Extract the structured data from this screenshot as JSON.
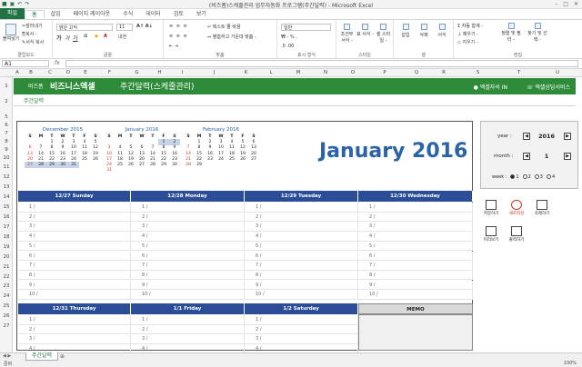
{
  "window": {
    "title": "(비즈폼)스케줄관리 업무자동화 프로그램(주간달력) - Microsoft Excel",
    "controls": [
      "–",
      "□",
      "✕"
    ]
  },
  "ribbon_tabs": [
    {
      "label": "파일"
    },
    {
      "label": "홈"
    },
    {
      "label": "삽입"
    },
    {
      "label": "페이지 레이아웃"
    },
    {
      "label": "수식"
    },
    {
      "label": "데이터"
    },
    {
      "label": "검토"
    },
    {
      "label": "보기"
    }
  ],
  "ribbon": {
    "clipboard": {
      "paste": "붙여넣기",
      "cut": "잘라내기",
      "copy": "복사 -",
      "format_painter": "서식 복사",
      "group": "클립보드"
    },
    "font": {
      "name": "맑은 고딕",
      "size": "11",
      "group": "글꼴"
    },
    "alignment": {
      "wrap": "텍스트 줄 바꿈",
      "merge": "병합하고 가운데 맞춤 -",
      "group": "맞춤"
    },
    "number": {
      "format": "일반",
      "group": "표시 형식"
    },
    "styles": {
      "cond": "조건부 서식 -",
      "table": "표 서식 -",
      "cell": "셀 스타일 -",
      "group": "스타일"
    },
    "cells": {
      "insert": "삽입",
      "delete": "삭제",
      "format": "서식",
      "group": "셀"
    },
    "editing": {
      "autosum": "자동 합계 -",
      "fill": "채우기 -",
      "clear": "지우기 -",
      "sort": "정렬 및 필터 -",
      "find": "찾기 및 선택 -",
      "group": "편집"
    }
  },
  "formula_bar": {
    "name_box": "A1",
    "fx": "fx",
    "value": ""
  },
  "columns": [
    "A",
    "B",
    "C",
    "D",
    "E",
    "F",
    "G",
    "H",
    "I",
    "J",
    "K",
    "L",
    "M",
    "N",
    "O",
    "P",
    "Q",
    "R",
    "S",
    "T",
    "U"
  ],
  "rows": [
    "1",
    "2",
    "5",
    "6",
    "7",
    "8",
    "9",
    "10",
    "11",
    "12",
    "13",
    "14",
    "15",
    "16",
    "17",
    "18",
    "19",
    "20",
    "21",
    "22",
    "23",
    "24",
    "25",
    "26",
    "27"
  ],
  "banner": {
    "brand_small": "비즈폼",
    "brand": "비즈니스엑셀",
    "title": "주간달력(스케줄관리)",
    "link1": "엑셀자석 IN",
    "link2": "엑셀상담서비스"
  },
  "subtitle": "주간달력",
  "mini_calendars": [
    {
      "title": "December 2015",
      "dow": [
        "S",
        "M",
        "T",
        "W",
        "T",
        "F",
        "S"
      ],
      "weeks": [
        [
          "",
          "",
          "1",
          "2",
          "3",
          "4",
          "5"
        ],
        [
          "6",
          "7",
          "8",
          "9",
          "10",
          "11",
          "12"
        ],
        [
          "13",
          "14",
          "15",
          "16",
          "17",
          "18",
          "19"
        ],
        [
          "20",
          "21",
          "22",
          "23",
          "24",
          "25",
          "26"
        ],
        [
          "27",
          "28",
          "29",
          "30",
          "31",
          "",
          ""
        ],
        [
          "",
          "",
          "",
          "",
          "",
          "",
          ""
        ]
      ]
    },
    {
      "title": "January 2016",
      "dow": [
        "S",
        "M",
        "T",
        "W",
        "T",
        "F",
        "S"
      ],
      "weeks": [
        [
          "",
          "",
          "",
          "",
          "",
          "1",
          "2"
        ],
        [
          "3",
          "4",
          "5",
          "6",
          "7",
          "8",
          "9"
        ],
        [
          "10",
          "11",
          "12",
          "13",
          "14",
          "15",
          "16"
        ],
        [
          "17",
          "18",
          "19",
          "20",
          "21",
          "22",
          "23"
        ],
        [
          "24",
          "25",
          "26",
          "27",
          "28",
          "29",
          "30"
        ],
        [
          "31",
          "",
          "",
          "",
          "",
          "",
          ""
        ]
      ]
    },
    {
      "title": "February 2016",
      "dow": [
        "S",
        "M",
        "T",
        "W",
        "T",
        "F",
        "S"
      ],
      "weeks": [
        [
          "",
          "1",
          "2",
          "3",
          "4",
          "5",
          "6"
        ],
        [
          "7",
          "8",
          "9",
          "10",
          "11",
          "12",
          "13"
        ],
        [
          "14",
          "15",
          "16",
          "17",
          "18",
          "19",
          "20"
        ],
        [
          "21",
          "22",
          "23",
          "24",
          "25",
          "26",
          "27"
        ],
        [
          "28",
          "29",
          "",
          "",
          "",
          "",
          ""
        ],
        [
          "",
          "",
          "",
          "",
          "",
          "",
          ""
        ]
      ]
    }
  ],
  "big_month": "January 2016",
  "week_headers": [
    "12/27  Sunday",
    "12/28  Monday",
    "12/29  Tuesday",
    "12/30  Wednesday"
  ],
  "week_headers2": [
    "12/31  Thursday",
    "1/1  Friday",
    "1/2  Saturday"
  ],
  "memo": "MEMO",
  "slots": [
    "1 /",
    "2 /",
    "3 /",
    "4 /",
    "5 /",
    "6 /",
    "7 /",
    "8 /",
    "9 /",
    "10 /"
  ],
  "slots_short": [
    "1 /",
    "2 /",
    "3 /",
    "4 /"
  ],
  "controls": {
    "year_label": "year :",
    "year": "2016",
    "month_label": "month :",
    "month": "1",
    "week_label": "week :",
    "weeks": [
      "1",
      "2",
      "3",
      "4"
    ],
    "selected_week": "1"
  },
  "tools": [
    {
      "label": "저장하기",
      "icon": "folder-icon"
    },
    {
      "label": "새로작성",
      "icon": "refresh-icon"
    },
    {
      "label": "삭제하기",
      "icon": "trash-icon"
    },
    {
      "label": "미리보기",
      "icon": "monitor-icon"
    },
    {
      "label": "출력하기",
      "icon": "printer-icon"
    }
  ],
  "sheet_tab": "주간달력",
  "status": {
    "left": "준비",
    "zoom": "100%"
  },
  "colors": {
    "excel_green": "#217346",
    "banner": "#2e8b3a",
    "header_blue": "#2b4d97",
    "title_blue": "#2b63a6"
  }
}
